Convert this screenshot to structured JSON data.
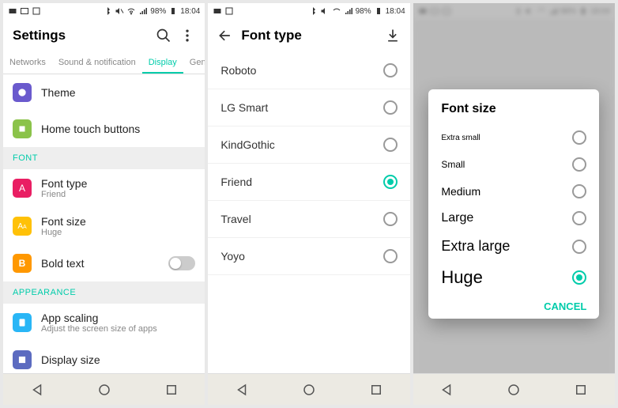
{
  "statusbar": {
    "battery_pct": "98%",
    "time": "18:04"
  },
  "screen1": {
    "title": "Settings",
    "tabs": [
      "Networks",
      "Sound & notification",
      "Display",
      "General"
    ],
    "active_tab": 2,
    "items": {
      "theme": "Theme",
      "home_buttons": "Home touch buttons"
    },
    "sections": {
      "font": "FONT",
      "appearance": "APPEARANCE"
    },
    "font_type": {
      "label": "Font type",
      "value": "Friend"
    },
    "font_size": {
      "label": "Font size",
      "value": "Huge"
    },
    "bold_text": {
      "label": "Bold text"
    },
    "app_scaling": {
      "label": "App scaling",
      "sub": "Adjust the screen size of apps"
    },
    "display_size": {
      "label": "Display size"
    }
  },
  "screen2": {
    "title": "Font type",
    "fonts": [
      "Roboto",
      "LG Smart",
      "KindGothic",
      "Friend",
      "Travel",
      "Yoyo"
    ],
    "selected": "Friend"
  },
  "screen3": {
    "dialog_title": "Font size",
    "options": [
      {
        "label": "Extra small",
        "cls": "sz-xs"
      },
      {
        "label": "Small",
        "cls": "sz-sm"
      },
      {
        "label": "Medium",
        "cls": "sz-md"
      },
      {
        "label": "Large",
        "cls": "sz-lg"
      },
      {
        "label": "Extra large",
        "cls": "sz-xl"
      },
      {
        "label": "Huge",
        "cls": "sz-hg"
      }
    ],
    "selected": "Huge",
    "cancel": "CANCEL"
  },
  "colors": {
    "accent": "#00bfa5",
    "icon_purple": "#6a5acd",
    "icon_green": "#8bc34a",
    "icon_pink": "#e91e63",
    "icon_yellow": "#ffc107",
    "icon_orange": "#ff9800",
    "icon_blue": "#29b6f6"
  }
}
